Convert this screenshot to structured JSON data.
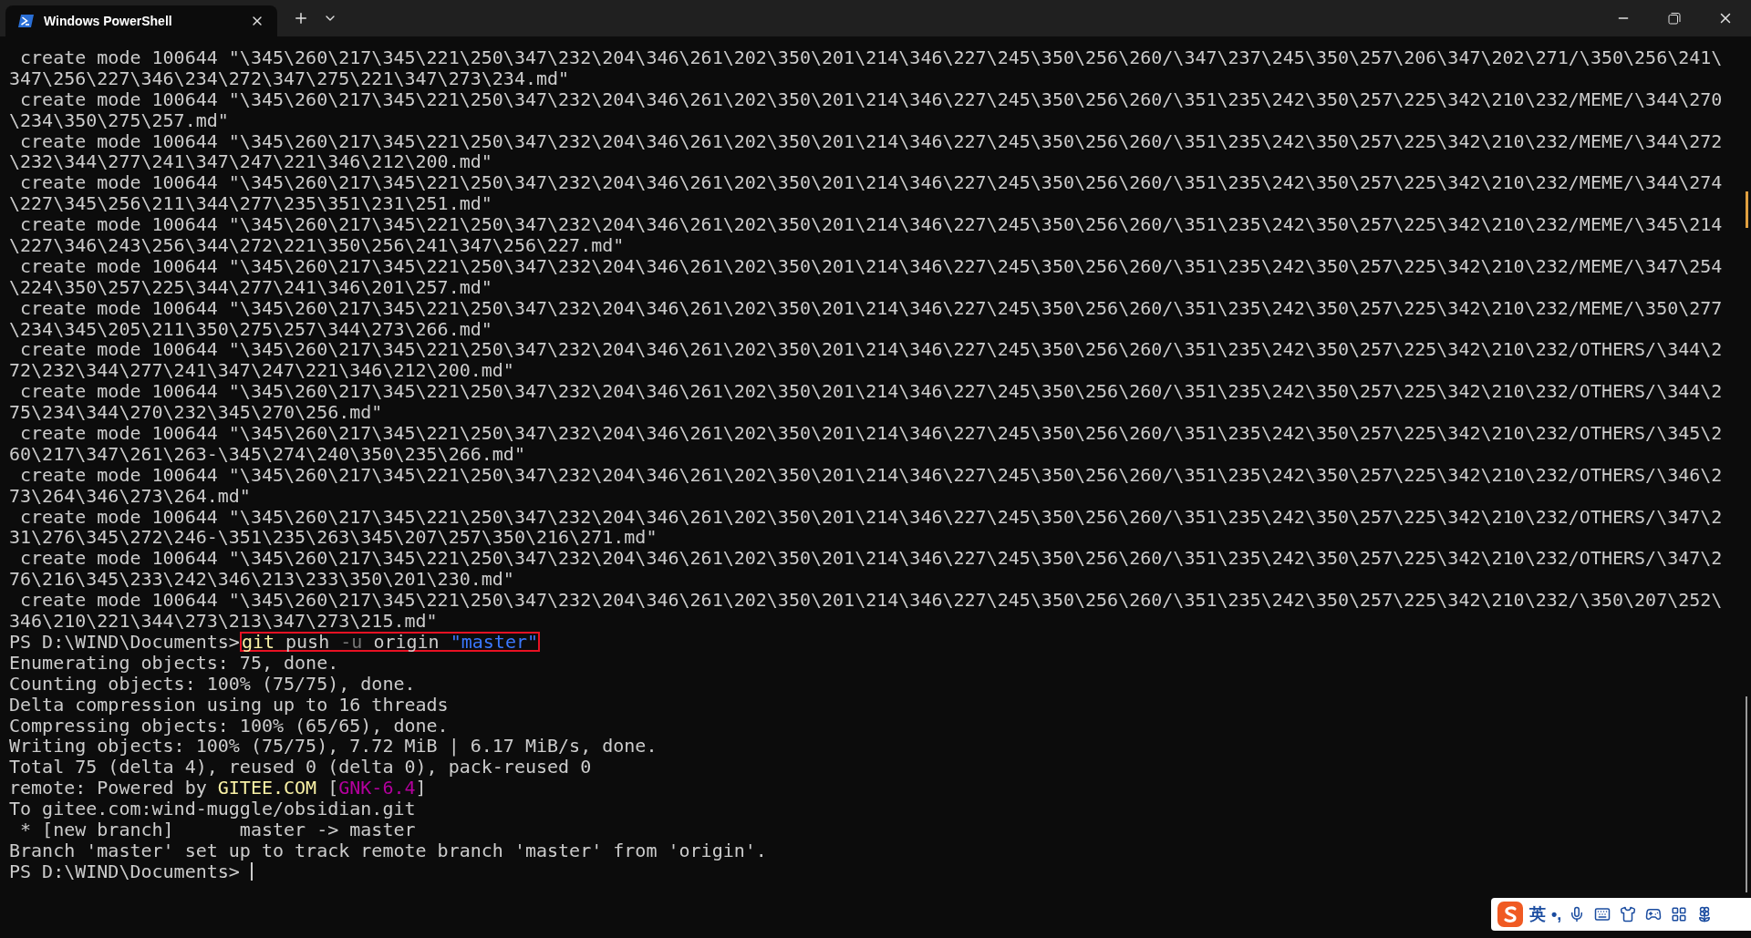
{
  "tabs": [
    {
      "title": "Windows PowerShell",
      "selected": true
    }
  ],
  "lines": [
    {
      "kind": "text",
      "text": " create mode 100644 \"\\345\\260\\217\\345\\221\\250\\347\\232\\204\\346\\261\\202\\350\\201\\214\\346\\227\\245\\350\\256\\260/\\347\\237\\245\\350\\257\\206\\347\\202\\271/\\350\\256\\241\\"
    },
    {
      "kind": "text",
      "text": "347\\256\\227\\346\\234\\272\\347\\275\\221\\347\\273\\234.md\""
    },
    {
      "kind": "text",
      "text": " create mode 100644 \"\\345\\260\\217\\345\\221\\250\\347\\232\\204\\346\\261\\202\\350\\201\\214\\346\\227\\245\\350\\256\\260/\\351\\235\\242\\350\\257\\225\\342\\210\\232/MEME/\\344\\270"
    },
    {
      "kind": "text",
      "text": "\\234\\350\\275\\257.md\""
    },
    {
      "kind": "text",
      "text": " create mode 100644 \"\\345\\260\\217\\345\\221\\250\\347\\232\\204\\346\\261\\202\\350\\201\\214\\346\\227\\245\\350\\256\\260/\\351\\235\\242\\350\\257\\225\\342\\210\\232/MEME/\\344\\272"
    },
    {
      "kind": "text",
      "text": "\\232\\344\\277\\241\\347\\247\\221\\346\\212\\200.md\""
    },
    {
      "kind": "text",
      "text": " create mode 100644 \"\\345\\260\\217\\345\\221\\250\\347\\232\\204\\346\\261\\202\\350\\201\\214\\346\\227\\245\\350\\256\\260/\\351\\235\\242\\350\\257\\225\\342\\210\\232/MEME/\\344\\274"
    },
    {
      "kind": "text",
      "text": "\\227\\345\\256\\211\\344\\277\\235\\351\\231\\251.md\""
    },
    {
      "kind": "text",
      "text": " create mode 100644 \"\\345\\260\\217\\345\\221\\250\\347\\232\\204\\346\\261\\202\\350\\201\\214\\346\\227\\245\\350\\256\\260/\\351\\235\\242\\350\\257\\225\\342\\210\\232/MEME/\\345\\214"
    },
    {
      "kind": "text",
      "text": "\\227\\346\\243\\256\\344\\272\\221\\350\\256\\241\\347\\256\\227.md\""
    },
    {
      "kind": "text",
      "text": " create mode 100644 \"\\345\\260\\217\\345\\221\\250\\347\\232\\204\\346\\261\\202\\350\\201\\214\\346\\227\\245\\350\\256\\260/\\351\\235\\242\\350\\257\\225\\342\\210\\232/MEME/\\347\\254"
    },
    {
      "kind": "text",
      "text": "\\224\\350\\257\\225\\344\\277\\241\\346\\201\\257.md\""
    },
    {
      "kind": "text",
      "text": " create mode 100644 \"\\345\\260\\217\\345\\221\\250\\347\\232\\204\\346\\261\\202\\350\\201\\214\\346\\227\\245\\350\\256\\260/\\351\\235\\242\\350\\257\\225\\342\\210\\232/MEME/\\350\\277"
    },
    {
      "kind": "text",
      "text": "\\234\\345\\205\\211\\350\\275\\257\\344\\273\\266.md\""
    },
    {
      "kind": "text",
      "text": " create mode 100644 \"\\345\\260\\217\\345\\221\\250\\347\\232\\204\\346\\261\\202\\350\\201\\214\\346\\227\\245\\350\\256\\260/\\351\\235\\242\\350\\257\\225\\342\\210\\232/OTHERS/\\344\\2"
    },
    {
      "kind": "text",
      "text": "72\\232\\344\\277\\241\\347\\247\\221\\346\\212\\200.md\""
    },
    {
      "kind": "text",
      "text": " create mode 100644 \"\\345\\260\\217\\345\\221\\250\\347\\232\\204\\346\\261\\202\\350\\201\\214\\346\\227\\245\\350\\256\\260/\\351\\235\\242\\350\\257\\225\\342\\210\\232/OTHERS/\\344\\2"
    },
    {
      "kind": "text",
      "text": "75\\234\\344\\270\\232\\345\\270\\256.md\""
    },
    {
      "kind": "text",
      "text": " create mode 100644 \"\\345\\260\\217\\345\\221\\250\\347\\232\\204\\346\\261\\202\\350\\201\\214\\346\\227\\245\\350\\256\\260/\\351\\235\\242\\350\\257\\225\\342\\210\\232/OTHERS/\\345\\2"
    },
    {
      "kind": "text",
      "text": "60\\217\\347\\261\\263-\\345\\274\\240\\350\\235\\266.md\""
    },
    {
      "kind": "text",
      "text": " create mode 100644 \"\\345\\260\\217\\345\\221\\250\\347\\232\\204\\346\\261\\202\\350\\201\\214\\346\\227\\245\\350\\256\\260/\\351\\235\\242\\350\\257\\225\\342\\210\\232/OTHERS/\\346\\2"
    },
    {
      "kind": "text",
      "text": "73\\264\\346\\273\\264.md\""
    },
    {
      "kind": "text",
      "text": " create mode 100644 \"\\345\\260\\217\\345\\221\\250\\347\\232\\204\\346\\261\\202\\350\\201\\214\\346\\227\\245\\350\\256\\260/\\351\\235\\242\\350\\257\\225\\342\\210\\232/OTHERS/\\347\\2"
    },
    {
      "kind": "text",
      "text": "31\\276\\345\\272\\246-\\351\\235\\263\\345\\207\\257\\350\\216\\271.md\""
    },
    {
      "kind": "text",
      "text": " create mode 100644 \"\\345\\260\\217\\345\\221\\250\\347\\232\\204\\346\\261\\202\\350\\201\\214\\346\\227\\245\\350\\256\\260/\\351\\235\\242\\350\\257\\225\\342\\210\\232/OTHERS/\\347\\2"
    },
    {
      "kind": "text",
      "text": "76\\216\\345\\233\\242\\346\\213\\233\\350\\201\\230.md\""
    },
    {
      "kind": "text",
      "text": " create mode 100644 \"\\345\\260\\217\\345\\221\\250\\347\\232\\204\\346\\261\\202\\350\\201\\214\\346\\227\\245\\350\\256\\260/\\351\\235\\242\\350\\257\\225\\342\\210\\232/\\350\\207\\252\\"
    },
    {
      "kind": "text",
      "text": "346\\210\\221\\344\\273\\213\\347\\273\\215.md\""
    },
    {
      "kind": "command",
      "prompt": "PS D:\\WIND\\Documents>",
      "highlighted": true,
      "segments": [
        {
          "text": "git",
          "kind": "command"
        },
        {
          "text": " push",
          "kind": "plain"
        },
        {
          "text": " -u",
          "kind": "flag"
        },
        {
          "text": " origin",
          "kind": "plain"
        },
        {
          "text": " \"master\"",
          "kind": "string"
        }
      ]
    },
    {
      "kind": "text",
      "text": "Enumerating objects: 75, done."
    },
    {
      "kind": "text",
      "text": "Counting objects: 100% (75/75), done."
    },
    {
      "kind": "text",
      "text": "Delta compression using up to 16 threads"
    },
    {
      "kind": "text",
      "text": "Compressing objects: 100% (65/65), done."
    },
    {
      "kind": "text",
      "text": "Writing objects: 100% (75/75), 7.72 MiB | 6.17 MiB/s, done."
    },
    {
      "kind": "text",
      "text": "Total 75 (delta 4), reused 0 (delta 0), pack-reused 0"
    },
    {
      "kind": "mixed",
      "segments": [
        {
          "text": "remote: Powered by ",
          "kind": "plain"
        },
        {
          "text": "GITEE.COM",
          "kind": "brand"
        },
        {
          "text": " [",
          "kind": "plain"
        },
        {
          "text": "GNK-6.4",
          "kind": "tag"
        },
        {
          "text": "]",
          "kind": "plain"
        }
      ]
    },
    {
      "kind": "text",
      "text": "To gitee.com:wind-muggle/obsidian.git"
    },
    {
      "kind": "text",
      "text": " * [new branch]      master -> master"
    },
    {
      "kind": "text",
      "text": "Branch 'master' set up to track remote branch 'master' from 'origin'."
    },
    {
      "kind": "prompt",
      "prompt": "PS D:\\WIND\\Documents>",
      "cursor": true
    }
  ],
  "ime_bar": {
    "mode": "英",
    "punctuation": "•,"
  }
}
